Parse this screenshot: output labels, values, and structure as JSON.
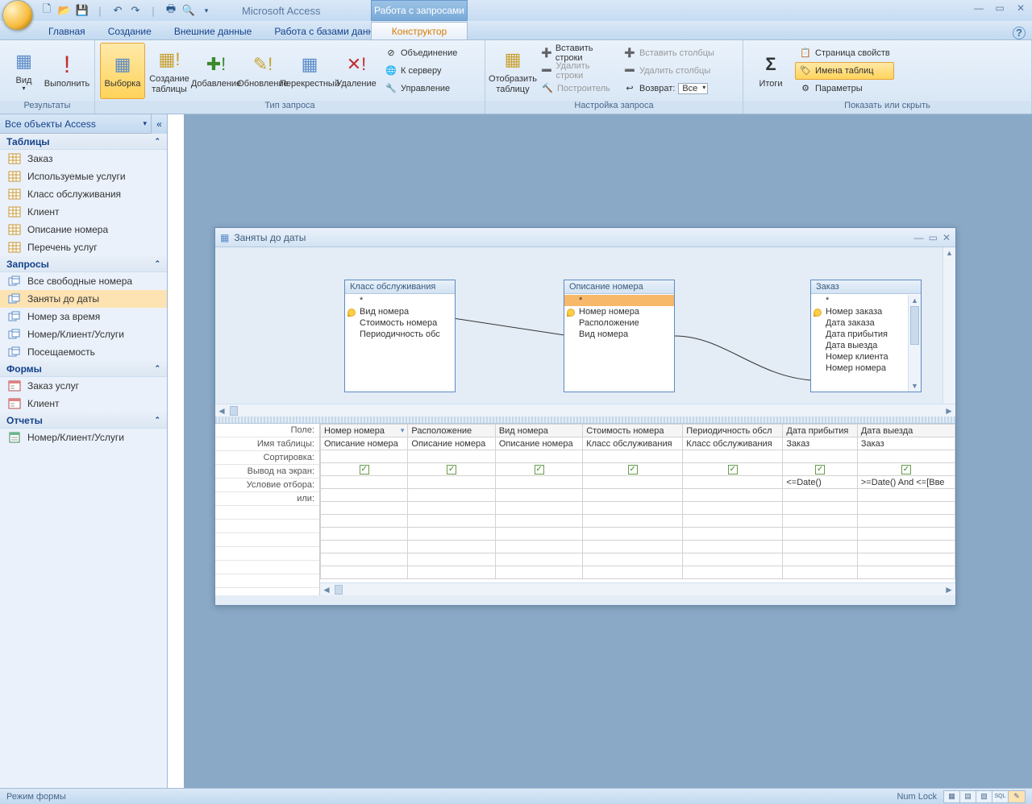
{
  "app_title": "Microsoft Access",
  "context_title": "Работа с запросами",
  "tabs": {
    "home": "Главная",
    "create": "Создание",
    "external": "Внешние данные",
    "db_tools": "Работа с базами данных",
    "designer": "Конструктор"
  },
  "ribbon": {
    "results": {
      "label": "Результаты",
      "view": "Вид",
      "run": "Выполнить"
    },
    "query_type": {
      "label": "Тип запроса",
      "select": "Выборка",
      "make_table": "Создание таблицы",
      "append": "Добавление",
      "update": "Обновление",
      "crosstab": "Перекрестный",
      "delete": "Удаление",
      "union": "Объединение",
      "passthrough": "К серверу",
      "definition": "Управление"
    },
    "show_table": "Отобразить таблицу",
    "setup": {
      "label": "Настройка запроса",
      "insert_rows": "Вставить строки",
      "delete_rows": "Удалить строки",
      "builder": "Построитель",
      "insert_cols": "Вставить столбцы",
      "delete_cols": "Удалить столбцы",
      "return": "Возврат:",
      "return_val": "Все"
    },
    "showhide": {
      "label": "Показать или скрыть",
      "totals": "Итоги",
      "propsheet": "Страница свойств",
      "tablenames": "Имена таблиц",
      "params": "Параметры"
    }
  },
  "nav": {
    "title": "Все объекты Access",
    "sections": {
      "tables": "Таблицы",
      "queries": "Запросы",
      "forms": "Формы",
      "reports": "Отчеты"
    },
    "tables_items": [
      "Заказ",
      "Используемые услуги",
      "Класс обслуживания",
      "Клиент",
      "Описание номера",
      "Перечень услуг"
    ],
    "queries_items": [
      "Все свободные номера",
      "Заняты до даты",
      "Номер за время",
      "Номер/Клиент/Услуги",
      "Посещаемость"
    ],
    "queries_selected": "Заняты до даты",
    "forms_items": [
      "Заказ услуг",
      "Клиент"
    ],
    "reports_items": [
      "Номер/Клиент/Услуги"
    ]
  },
  "mdi": {
    "title": "Заняты до даты",
    "table1": {
      "name": "Класс обслуживания",
      "fields": [
        "*",
        "Вид номера",
        "Стоимость номера",
        "Периодичность обс"
      ],
      "key_idx": 1
    },
    "table2": {
      "name": "Описание номера",
      "fields": [
        "*",
        "Номер номера",
        "Расположение",
        "Вид номера"
      ],
      "key_idx": 1,
      "sel_idx": 0
    },
    "table3": {
      "name": "Заказ",
      "fields": [
        "*",
        "Номер заказа",
        "Дата заказа",
        "Дата прибытия",
        "Дата выезда",
        "Номер клиента",
        "Номер номера"
      ],
      "key_idx": 1
    },
    "grid_rows": [
      "Поле:",
      "Имя таблицы:",
      "Сортировка:",
      "Вывод на экран:",
      "Условие отбора:",
      "или:"
    ],
    "columns": [
      {
        "field": "Номер номера",
        "table": "Описание номера",
        "show": true,
        "criteria": "",
        "dropdown": true
      },
      {
        "field": "Расположение",
        "table": "Описание номера",
        "show": true,
        "criteria": ""
      },
      {
        "field": "Вид номера",
        "table": "Описание номера",
        "show": true,
        "criteria": ""
      },
      {
        "field": "Стоимость номера",
        "table": "Класс обслуживания",
        "show": true,
        "criteria": ""
      },
      {
        "field": "Периодичность обсл",
        "table": "Класс обслуживания",
        "show": true,
        "criteria": ""
      },
      {
        "field": "Дата прибытия",
        "table": "Заказ",
        "show": true,
        "criteria": "<=Date()"
      },
      {
        "field": "Дата выезда",
        "table": "Заказ",
        "show": true,
        "criteria": ">=Date() And <=[Вве"
      }
    ]
  },
  "status": {
    "left": "Режим формы",
    "numlock": "Num Lock"
  }
}
